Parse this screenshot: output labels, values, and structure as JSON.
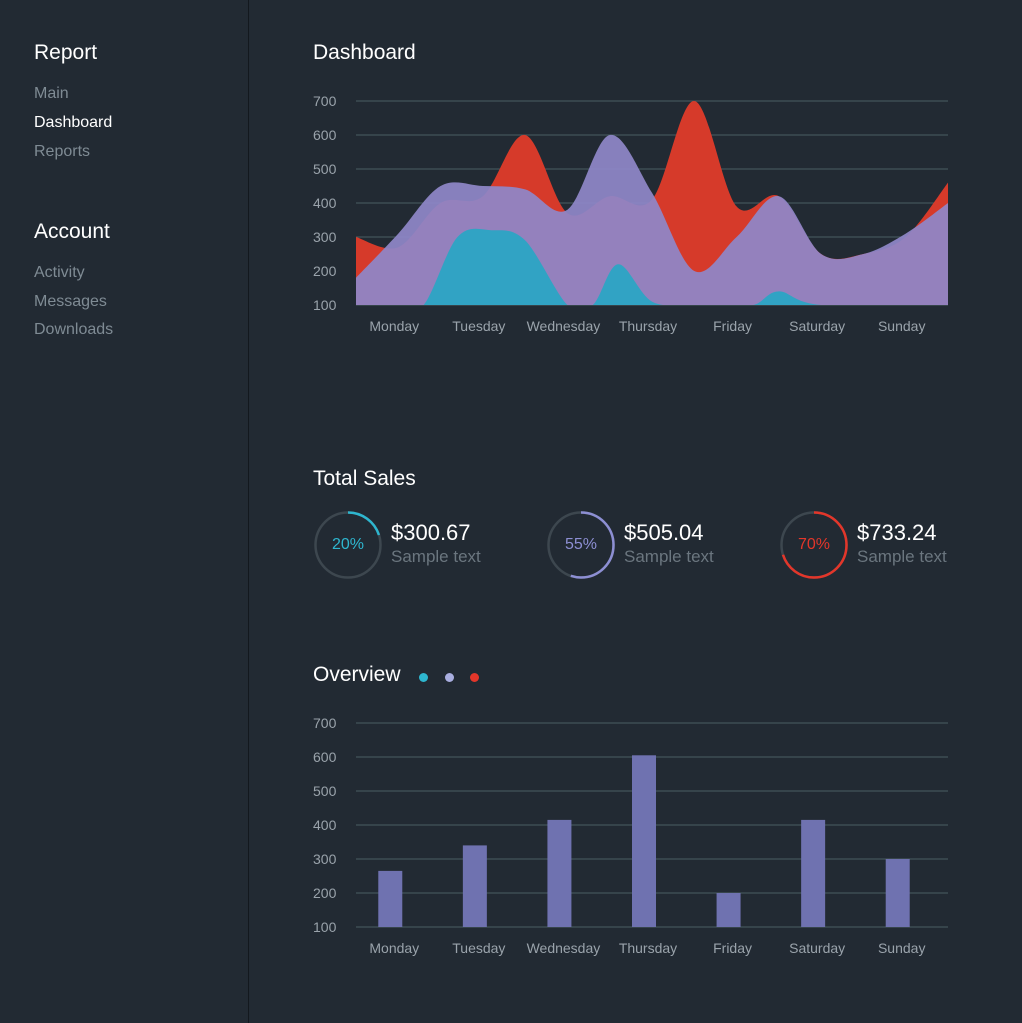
{
  "sidebar": {
    "sections": [
      {
        "heading": "Report",
        "items": [
          {
            "label": "Main"
          },
          {
            "label": "Dashboard"
          },
          {
            "label": "Reports"
          }
        ]
      },
      {
        "heading": "Account",
        "items": [
          {
            "label": "Activity"
          },
          {
            "label": "Messages"
          },
          {
            "label": "Downloads"
          }
        ]
      }
    ],
    "active_item": "Dashboard"
  },
  "dashboard": {
    "title": "Dashboard"
  },
  "total_sales": {
    "title": "Total Sales",
    "items": [
      {
        "percent_label": "20%",
        "percent": 0.2,
        "value": "$300.67",
        "sub": "Sample text",
        "color": "#2eb6cf"
      },
      {
        "percent_label": "55%",
        "percent": 0.55,
        "value": "$505.04",
        "sub": "Sample text",
        "color": "#8d8fd3"
      },
      {
        "percent_label": "70%",
        "percent": 0.7,
        "value": "$733.24",
        "sub": "Sample text",
        "color": "#e3362a"
      }
    ]
  },
  "overview": {
    "title": "Overview",
    "legend_colors": [
      "#2eb6cf",
      "#a9aee0",
      "#e3362a"
    ]
  },
  "colors": {
    "background": "#222a33",
    "grid": "#4a5e63",
    "axis_text": "#9aa3ab",
    "red": "#d63a2a",
    "purple": "#8f86c8",
    "cyan": "#2aa6c4",
    "bar": "#6f72b0"
  },
  "chart_data": [
    {
      "type": "area",
      "categories": [
        "Monday",
        "Tuesday",
        "Wednesday",
        "Thursday",
        "Friday",
        "Saturday",
        "Sunday"
      ],
      "ylim": [
        100,
        700
      ],
      "yticks": [
        100,
        200,
        300,
        400,
        500,
        600,
        700
      ],
      "grid": true,
      "series": [
        {
          "color": "#d63a2a",
          "x": [
            0,
            0.5,
            1,
            1.5,
            2,
            2.5,
            3,
            3.5,
            4,
            4.5,
            5,
            5.5,
            6,
            6.5,
            7
          ],
          "values": [
            300,
            270,
            400,
            420,
            600,
            370,
            420,
            410,
            700,
            390,
            420,
            250,
            250,
            300,
            460
          ]
        },
        {
          "color": "#8f86c8",
          "x": [
            0,
            0.5,
            1,
            1.5,
            2,
            2.5,
            3,
            3.5,
            4,
            4.5,
            5,
            5.5,
            6,
            6.5,
            7
          ],
          "values": [
            180,
            310,
            450,
            450,
            440,
            380,
            600,
            430,
            200,
            300,
            420,
            250,
            250,
            310,
            400
          ]
        },
        {
          "color": "#2aa6c4",
          "x": [
            0,
            0.5,
            0.8,
            1.2,
            1.6,
            2,
            2.5,
            2.8,
            3.1,
            3.5,
            4,
            4.3,
            4.7,
            5,
            5.5,
            7
          ],
          "values": [
            100,
            100,
            100,
            300,
            320,
            290,
            100,
            100,
            220,
            110,
            100,
            100,
            100,
            140,
            100,
            100
          ]
        }
      ]
    },
    {
      "type": "bar",
      "categories": [
        "Monday",
        "Tuesday",
        "Wednesday",
        "Thursday",
        "Friday",
        "Saturday",
        "Sunday"
      ],
      "values": [
        265,
        340,
        415,
        605,
        200,
        415,
        300
      ],
      "ylim": [
        100,
        700
      ],
      "yticks": [
        100,
        200,
        300,
        400,
        500,
        600,
        700
      ],
      "grid": true,
      "color": "#6f72b0"
    }
  ]
}
